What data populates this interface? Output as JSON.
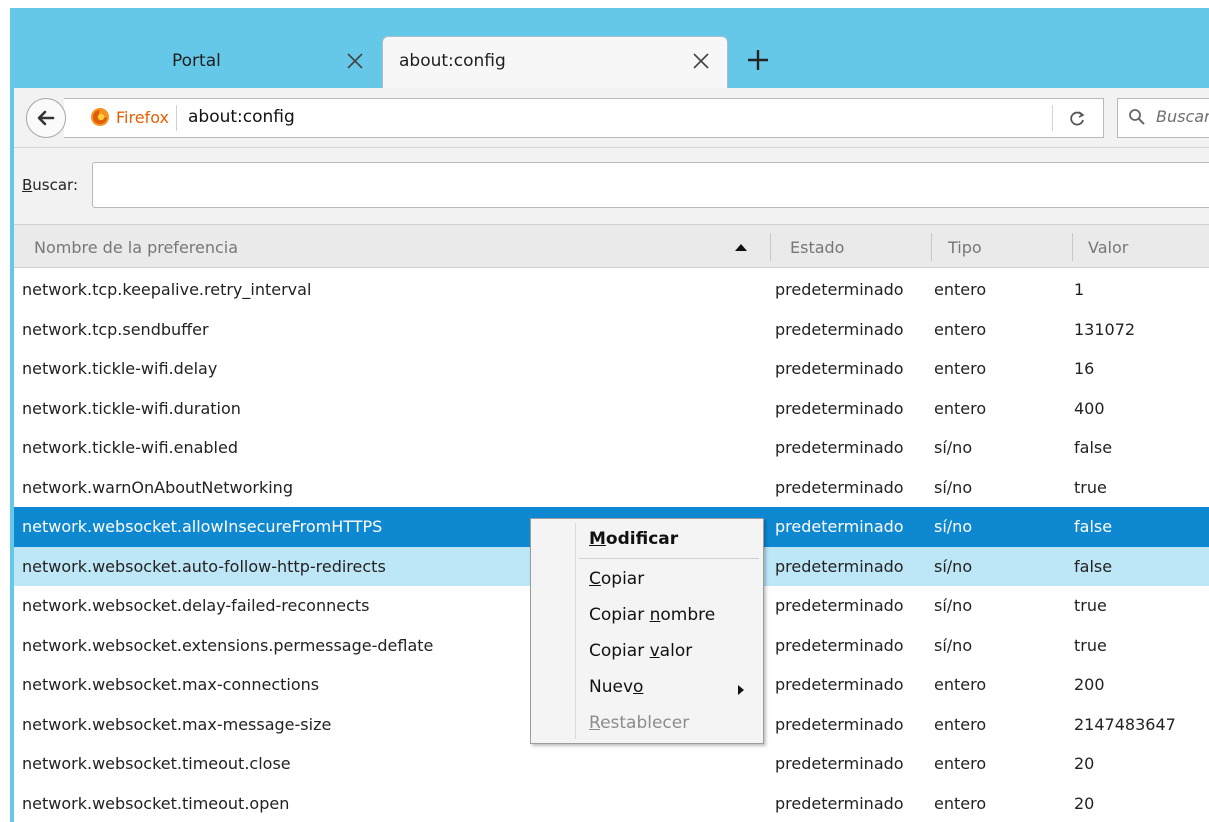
{
  "tabs": [
    {
      "label": "Portal",
      "active": false
    },
    {
      "label": "about:config",
      "active": true
    }
  ],
  "navbar": {
    "identity_label": "Firefox",
    "url": "about:config",
    "search_placeholder": "Buscar"
  },
  "filter": {
    "label_first": "B",
    "label_rest": "uscar:",
    "value": ""
  },
  "table": {
    "headers": {
      "name": "Nombre de la preferencia",
      "status": "Estado",
      "type": "Tipo",
      "value": "Valor"
    },
    "rows": [
      {
        "name": "network.tcp.keepalive.retry_interval",
        "status": "predeterminado",
        "type": "entero",
        "value": "1"
      },
      {
        "name": "network.tcp.sendbuffer",
        "status": "predeterminado",
        "type": "entero",
        "value": "131072"
      },
      {
        "name": "network.tickle-wifi.delay",
        "status": "predeterminado",
        "type": "entero",
        "value": "16"
      },
      {
        "name": "network.tickle-wifi.duration",
        "status": "predeterminado",
        "type": "entero",
        "value": "400"
      },
      {
        "name": "network.tickle-wifi.enabled",
        "status": "predeterminado",
        "type": "sí/no",
        "value": "false"
      },
      {
        "name": "network.warnOnAboutNetworking",
        "status": "predeterminado",
        "type": "sí/no",
        "value": "true"
      },
      {
        "name": "network.websocket.allowInsecureFromHTTPS",
        "status": "predeterminado",
        "type": "sí/no",
        "value": "false"
      },
      {
        "name": "network.websocket.auto-follow-http-redirects",
        "status": "predeterminado",
        "type": "sí/no",
        "value": "false"
      },
      {
        "name": "network.websocket.delay-failed-reconnects",
        "status": "predeterminado",
        "type": "sí/no",
        "value": "true"
      },
      {
        "name": "network.websocket.extensions.permessage-deflate",
        "status": "predeterminado",
        "type": "sí/no",
        "value": "true"
      },
      {
        "name": "network.websocket.max-connections",
        "status": "predeterminado",
        "type": "entero",
        "value": "200"
      },
      {
        "name": "network.websocket.max-message-size",
        "status": "predeterminado",
        "type": "entero",
        "value": "2147483647"
      },
      {
        "name": "network.websocket.timeout.close",
        "status": "predeterminado",
        "type": "entero",
        "value": "20"
      },
      {
        "name": "network.websocket.timeout.open",
        "status": "predeterminado",
        "type": "entero",
        "value": "20"
      }
    ]
  },
  "context_menu": {
    "modify": {
      "pre": "",
      "key": "M",
      "post": "odificar"
    },
    "copy": {
      "pre": "",
      "key": "C",
      "post": "opiar"
    },
    "copy_name": {
      "pre": "Copiar ",
      "key": "n",
      "post": "ombre"
    },
    "copy_value": {
      "pre": "Copiar ",
      "key": "v",
      "post": "alor"
    },
    "new": {
      "pre": "Nuev",
      "key": "o",
      "post": ""
    },
    "reset": {
      "pre": "",
      "key": "R",
      "post": "establecer"
    }
  },
  "colors": {
    "titlebar": "#66c8e9",
    "selected_row": "#0f88d2",
    "hover_row": "#bde6f7",
    "firefox_orange": "#e66000"
  }
}
